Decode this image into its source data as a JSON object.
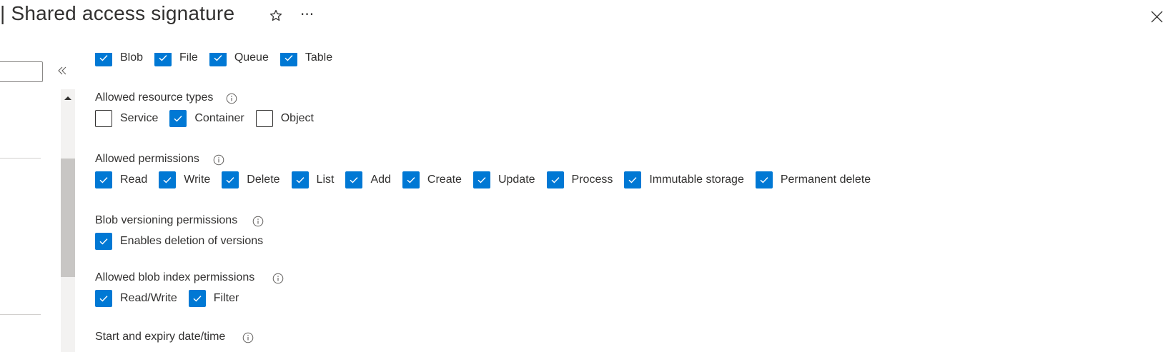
{
  "header": {
    "title": "| Shared access signature",
    "more_label": "···"
  },
  "sections": {
    "services": {
      "items": [
        {
          "label": "Blob",
          "checked": true
        },
        {
          "label": "File",
          "checked": true
        },
        {
          "label": "Queue",
          "checked": true
        },
        {
          "label": "Table",
          "checked": true
        }
      ]
    },
    "resource_types": {
      "title": "Allowed resource types",
      "items": [
        {
          "label": "Service",
          "checked": false
        },
        {
          "label": "Container",
          "checked": true
        },
        {
          "label": "Object",
          "checked": false
        }
      ]
    },
    "permissions": {
      "title": "Allowed permissions",
      "items": [
        {
          "label": "Read",
          "checked": true
        },
        {
          "label": "Write",
          "checked": true
        },
        {
          "label": "Delete",
          "checked": true
        },
        {
          "label": "List",
          "checked": true
        },
        {
          "label": "Add",
          "checked": true
        },
        {
          "label": "Create",
          "checked": true
        },
        {
          "label": "Update",
          "checked": true
        },
        {
          "label": "Process",
          "checked": true
        },
        {
          "label": "Immutable storage",
          "checked": true
        },
        {
          "label": "Permanent delete",
          "checked": true
        }
      ]
    },
    "versioning": {
      "title": "Blob versioning permissions",
      "items": [
        {
          "label": "Enables deletion of versions",
          "checked": true
        }
      ]
    },
    "blob_index": {
      "title": "Allowed blob index permissions",
      "items": [
        {
          "label": "Read/Write",
          "checked": true
        },
        {
          "label": "Filter",
          "checked": true
        }
      ]
    },
    "dates": {
      "title": "Start and expiry date/time"
    }
  },
  "colors": {
    "accent": "#0078d4",
    "text": "#323130",
    "scrollbar_thumb": "#c8c6c4",
    "scrollbar_track": "#f3f2f1"
  },
  "icons": [
    "star-icon",
    "more-icon",
    "close-icon",
    "collapse-icon",
    "scroll-up-icon",
    "info-icon",
    "checkmark-icon"
  ]
}
